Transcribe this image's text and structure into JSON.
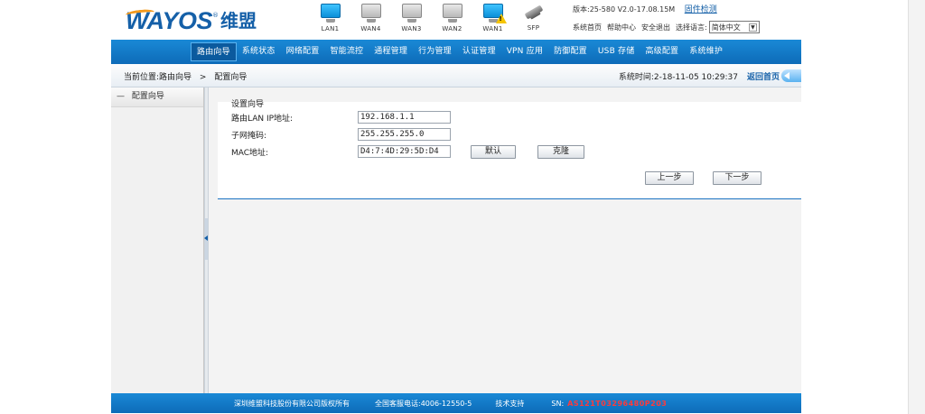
{
  "header": {
    "logo_text": "WAYOS",
    "logo_reg": "®",
    "logo_cn": "维盟",
    "ports": [
      {
        "label": "LAN1",
        "active": true,
        "warn": false
      },
      {
        "label": "WAN4",
        "active": false,
        "warn": false
      },
      {
        "label": "WAN3",
        "active": false,
        "warn": false
      },
      {
        "label": "WAN2",
        "active": false,
        "warn": false
      },
      {
        "label": "WAN1",
        "active": true,
        "warn": true
      }
    ],
    "sfp_label": "SFP",
    "version_text": "版本:25-580 V2.0-17.08.15M",
    "update_link": "固件检测",
    "links": [
      "系统首页",
      "帮助中心",
      "安全退出",
      "选择语言:"
    ],
    "language_selected": "简体中文"
  },
  "nav": {
    "items": [
      "路由向导",
      "系统状态",
      "网络配置",
      "智能流控",
      "通程管理",
      "行为管理",
      "认证管理",
      "VPN 应用",
      "防御配置",
      "USB 存储",
      "高级配置",
      "系统维护"
    ],
    "active_index": 0
  },
  "breadcrumb": {
    "prefix": "当前位置:路由向导",
    "separator": ">",
    "current": "配置向导",
    "system_time": "系统时间:2-18-11-05 10:29:37",
    "back_home": "返回首页"
  },
  "sidebar": {
    "items": [
      "配置向导"
    ]
  },
  "form": {
    "title": "设置向导",
    "lan_ip_label": "路由LAN IP地址:",
    "lan_ip_value": "192.168.1.1",
    "subnet_label": "子网掩码:",
    "subnet_value": "255.255.255.0",
    "mac_label": "MAC地址:",
    "mac_value": "D4:7:4D:29:5D:D4",
    "default_button": "默认",
    "clone_button": "克隆",
    "prev_button": "上一步",
    "next_button": "下一步"
  },
  "footer": {
    "copyright": "深圳维盟科技股份有限公司版权所有",
    "hotline": "全国客服电话:4006-12550-5",
    "support": "技术支持",
    "sn_label": "SN:",
    "sn_value": "AS121T03296480P203"
  },
  "colors": {
    "brand_blue": "#1560a8",
    "nav_blue": "#1a89d6",
    "sn_red": "#ff3a3a"
  }
}
